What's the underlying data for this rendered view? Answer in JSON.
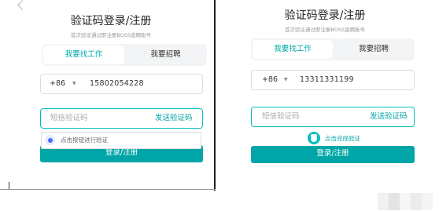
{
  "left": {
    "title": "验证码登录/注册",
    "subtitle": "首次验证通过即注册BOSS直聘账号",
    "tabs": {
      "job": "我要找工作",
      "hire": "我要招聘"
    },
    "country_code": "+86",
    "phone": "15802054228",
    "sms_placeholder": "短信验证码",
    "send_code": "发送验证码",
    "captcha_prompt": "点击按钮进行验证",
    "submit": "登录/注册"
  },
  "right": {
    "title": "验证码登录/注册",
    "subtitle": "首次验证通过即注册BOSS直聘账号",
    "tabs": {
      "job": "我要找工作",
      "hire": "我要招聘"
    },
    "country_code": "+86",
    "phone": "13311331199",
    "sms_placeholder": "短信验证码",
    "send_code": "发送验证码",
    "verified": "点击完成验证",
    "submit": "登录/注册"
  },
  "colors": {
    "accent": "#00a6a7",
    "captcha_blue": "#4a6cf7"
  }
}
